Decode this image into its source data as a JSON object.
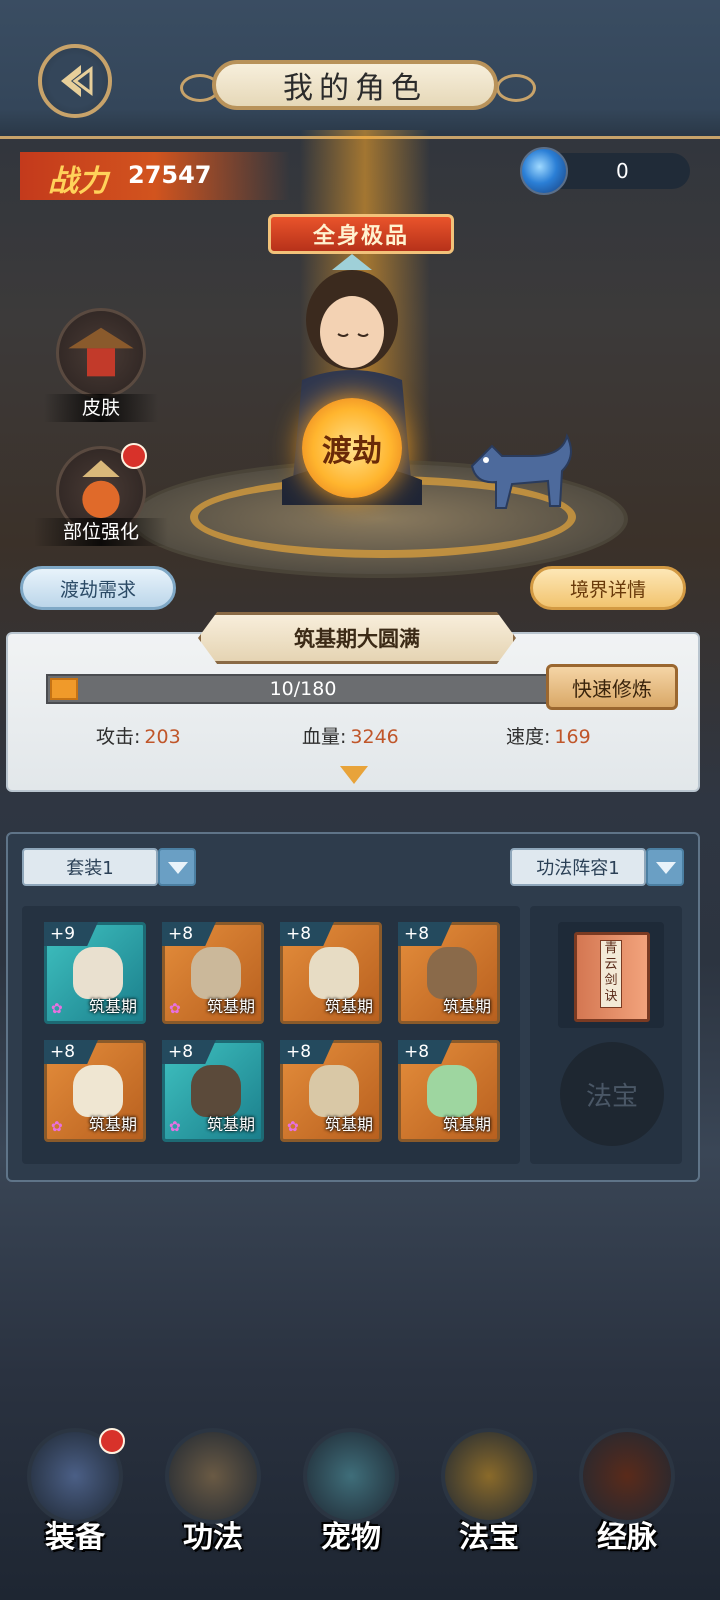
{
  "header": {
    "title": "我的角色",
    "back_icon": "back-arrow-icon"
  },
  "power": {
    "label": "战力",
    "value": "27547"
  },
  "currency": {
    "icon": "blue-orb-icon",
    "value": "0"
  },
  "scene": {
    "banner": "全身极品",
    "orb_label": "渡劫",
    "skin_label": "皮肤",
    "part_enhance_label": "部位强化"
  },
  "buttons": {
    "tribulation_req": "渡劫需求",
    "realm_details": "境界详情"
  },
  "realm": {
    "title": "筑基期大圆满",
    "progress_text": "10/180",
    "progress_fraction": 0.0556,
    "quick_train": "快速修炼",
    "stats": [
      {
        "key": "攻击:",
        "value": "203"
      },
      {
        "key": "血量:",
        "value": "3246"
      },
      {
        "key": "速度:",
        "value": "169"
      }
    ]
  },
  "equipment": {
    "set_select": "套装1",
    "formation_select": "功法阵容1",
    "slots": [
      {
        "level": "+9",
        "tier": "筑基期",
        "star": true,
        "bg": "teal",
        "icon": "dagger-icon"
      },
      {
        "level": "+8",
        "tier": "筑基期",
        "star": true,
        "bg": "orange",
        "icon": "armor-icon"
      },
      {
        "level": "+8",
        "tier": "筑基期",
        "star": false,
        "bg": "orange",
        "icon": "skull-helmet-icon"
      },
      {
        "level": "+8",
        "tier": "筑基期",
        "star": false,
        "bg": "orange",
        "icon": "boots-icon"
      },
      {
        "level": "+8",
        "tier": "筑基期",
        "star": true,
        "bg": "orange",
        "icon": "necklace-icon"
      },
      {
        "level": "+8",
        "tier": "筑基期",
        "star": true,
        "bg": "teal",
        "icon": "belt-icon"
      },
      {
        "level": "+8",
        "tier": "筑基期",
        "star": true,
        "bg": "orange",
        "icon": "bracelet-icon"
      },
      {
        "level": "+8",
        "tier": "筑基期",
        "star": false,
        "bg": "orange",
        "icon": "jade-ring-icon"
      }
    ],
    "book_label": "青云剑诀",
    "treasure_placeholder": "法宝"
  },
  "nav": [
    {
      "label": "装备",
      "icon": "armor-nav-icon",
      "badge": true
    },
    {
      "label": "功法",
      "icon": "scroll-nav-icon",
      "badge": false
    },
    {
      "label": "宠物",
      "icon": "dragon-pet-icon",
      "badge": false
    },
    {
      "label": "法宝",
      "icon": "golden-bell-icon",
      "badge": false
    },
    {
      "label": "经脉",
      "icon": "meridian-figure-icon",
      "badge": false
    }
  ],
  "colors": {
    "accent_gold": "#c8a36a",
    "power_red": "#c43a1c",
    "stat_value": "#c0562a",
    "progress": "#f09a2a",
    "badge_red": "#d8322a"
  }
}
